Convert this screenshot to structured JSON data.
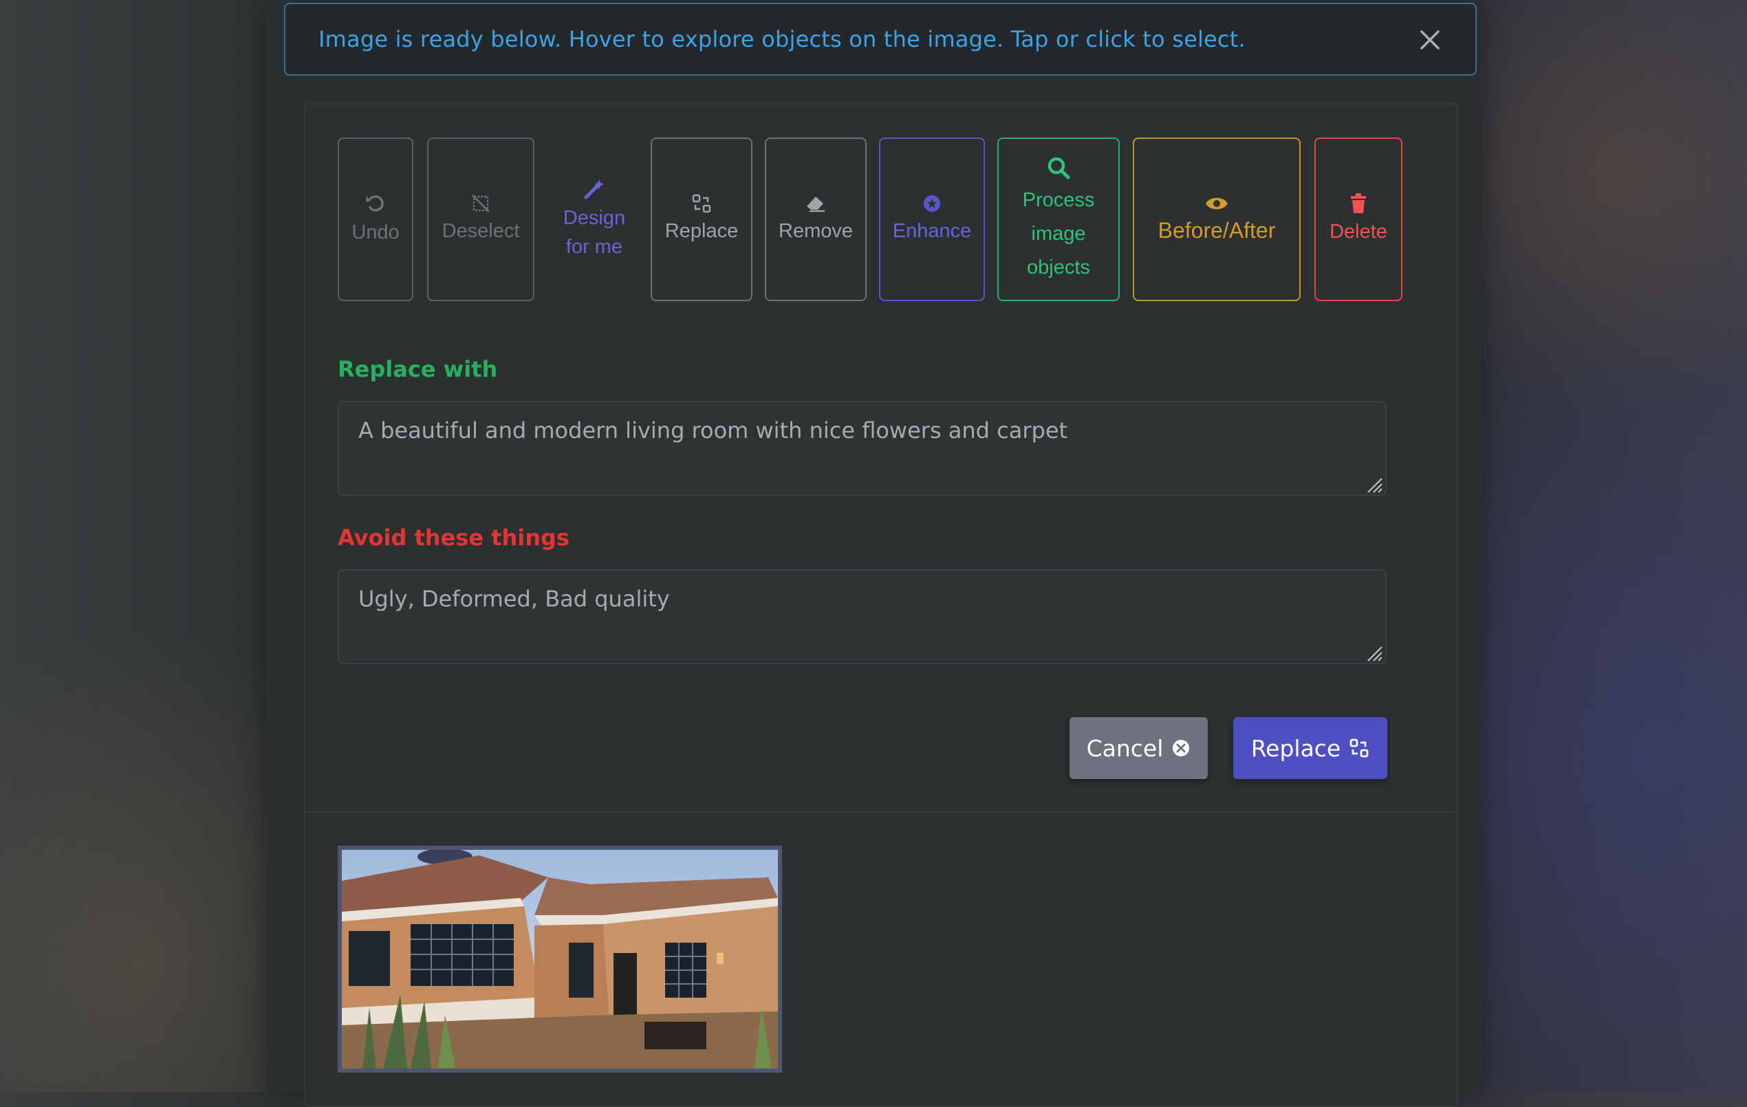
{
  "alert": {
    "message": "Image is ready below. Hover to explore objects on the image. Tap or click to select.",
    "close_icon": "close-icon"
  },
  "toolbar": {
    "undo": "Undo",
    "deselect": "Deselect",
    "design_line1": "Design",
    "design_line2": "for me",
    "replace": "Replace",
    "remove": "Remove",
    "enhance": "Enhance",
    "process_line1": "Process",
    "process_line2": "image",
    "process_line3": "objects",
    "before_after": "Before/After",
    "delete": "Delete"
  },
  "form": {
    "replace_label": "Replace with",
    "replace_value": "A beautiful and modern living room with nice flowers and carpet",
    "avoid_label": "Avoid these things",
    "avoid_value": "Ugly, Deformed, Bad quality",
    "cancel_label": "Cancel",
    "submit_label": "Replace"
  },
  "colors": {
    "accent_blue": "#3ea3e6",
    "purple": "#5857c7",
    "green": "#25b36b",
    "orange": "#c8942e",
    "red": "#e04848"
  }
}
